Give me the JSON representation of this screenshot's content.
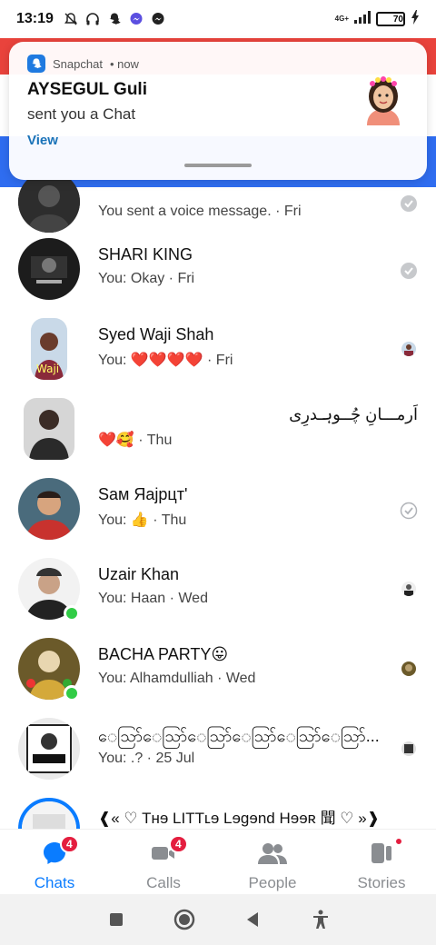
{
  "status_bar": {
    "time": "13:19",
    "network": "4G+",
    "battery": "70",
    "icons": [
      "mute-icon",
      "headphones-icon",
      "snapchat-icon",
      "messenger-icon",
      "messenger-icon"
    ]
  },
  "notification": {
    "app": "Snapchat",
    "when": "• now",
    "title": "AYSEGUL Guli",
    "text": "sent you a Chat",
    "action": "View"
  },
  "chats": [
    {
      "name": "",
      "preview": "You sent a voice message. · Fri",
      "receipt": "read-check"
    },
    {
      "name": "SHARI KING",
      "preview": "You: Okay · Fri",
      "receipt": "read-check"
    },
    {
      "name": "Syed Waji Shah",
      "preview": "You: ❤️❤️❤️❤️ · Fri",
      "receipt": "seen-avatar"
    },
    {
      "name": "اَرمـــانِ چُــوہـدرِی",
      "preview": "❤️🥰 · Thu",
      "receipt": "none"
    },
    {
      "name": "Sам Яајрцт'",
      "preview": "You: 👍 · Thu",
      "receipt": "sent-check"
    },
    {
      "name": "Uzair Khan",
      "preview": "You: Haan · Wed",
      "receipt": "seen-avatar",
      "online": true
    },
    {
      "name": "BACHA PARTY😛",
      "preview": "You: Alhamdulliah · Wed",
      "receipt": "seen-avatar",
      "online": true
    },
    {
      "name": "ေသြာ်ေသြာ်ေသြာ်ေသြာ်ေသြာ်ေသြာ်...",
      "preview": "You: .? · 25 Jul",
      "receipt": "seen-avatar"
    },
    {
      "name": "❰« ♡ Tнɘ LITTʟɘ Lɘgɘnd Hɘɘʀ 聞 ♡ »❱",
      "preview": "",
      "receipt": "none"
    }
  ],
  "tabs": [
    {
      "label": "Chats",
      "badge": "4",
      "active": true
    },
    {
      "label": "Calls",
      "badge": "4",
      "active": false
    },
    {
      "label": "People",
      "badge": "",
      "active": false
    },
    {
      "label": "Stories",
      "badge": "",
      "active": false
    }
  ],
  "colors": {
    "accent": "#0a7cff",
    "badge": "#e41e3f",
    "online": "#31cc46",
    "notif_action": "#1a73b8",
    "header_red": "#e9433c",
    "header_blue": "#2f6df0"
  }
}
